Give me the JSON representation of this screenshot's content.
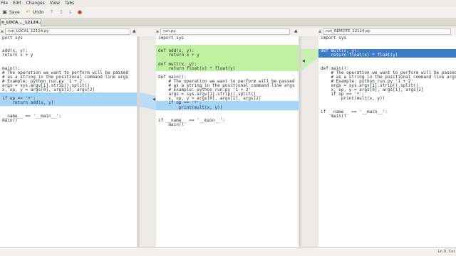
{
  "menu": [
    "File",
    "Edit",
    "Changes",
    "View",
    "Tabs"
  ],
  "toolbar": {
    "save": "Save",
    "undo": "Undo"
  },
  "tab": {
    "label": "n_LOCA..._12124.py"
  },
  "panes": {
    "left": {
      "file": "run_LOCAL_12124.py"
    },
    "middle": {
      "file": "run.py"
    },
    "right": {
      "file": "run_REMOTE_12124.py"
    }
  },
  "code": {
    "left": [
      {
        "t": "port sys",
        "c": ""
      },
      {
        "t": "",
        "c": ""
      },
      {
        "t": "",
        "c": ""
      },
      {
        "t": "add(x, y):",
        "c": ""
      },
      {
        "t": "return x + y",
        "c": ""
      },
      {
        "t": "",
        "c": ""
      },
      {
        "t": "",
        "c": ""
      },
      {
        "t": "main():",
        "c": ""
      },
      {
        "t": "# The operation we want to perform will be passed",
        "c": ""
      },
      {
        "t": "# as a string in the positional command line args",
        "c": ""
      },
      {
        "t": "# Example: python run.py '1 + 2'",
        "c": ""
      },
      {
        "t": "args = sys.argv[1].strip().split()",
        "c": ""
      },
      {
        "t": "x, op, y = args[0], args[1], args[2]",
        "c": ""
      },
      {
        "t": "",
        "c": "chg-b"
      },
      {
        "t": "if op == '+':",
        "c": "chg-b"
      },
      {
        "t": "    return add(x, y)",
        "c": "chg-b"
      },
      {
        "t": "",
        "c": ""
      },
      {
        "t": "",
        "c": ""
      },
      {
        "t": "__name__ == '__main__':",
        "c": ""
      },
      {
        "t": "main()",
        "c": ""
      }
    ],
    "middle": [
      {
        "t": "import sys",
        "c": ""
      },
      {
        "t": "",
        "c": ""
      },
      {
        "t": "",
        "c": "chg"
      },
      {
        "t": "def add(x, y):",
        "c": "chg"
      },
      {
        "t": "    return x + y",
        "c": "chg"
      },
      {
        "t": "",
        "c": "chg"
      },
      {
        "t": "def mult(x, y):",
        "c": "chg"
      },
      {
        "t": "    return float(x) * float(y)",
        "c": "chg"
      },
      {
        "t": "",
        "c": ""
      },
      {
        "t": "def main():",
        "c": ""
      },
      {
        "t": "    # The operation we want to perform will be passed",
        "c": ""
      },
      {
        "t": "    # as a string in the positional command line args",
        "c": ""
      },
      {
        "t": "    # Example: python run.py '1 + 2'",
        "c": ""
      },
      {
        "t": "    args = sys.argv[1].strip().split()",
        "c": ""
      },
      {
        "t": "    x, op, y = args[0], args[1], args[2]",
        "c": ""
      },
      {
        "t": "    if op == '*':",
        "c": "chg-b"
      },
      {
        "t": "        print(mult(x, y))",
        "c": "chg-b"
      },
      {
        "t": "",
        "c": ""
      },
      {
        "t": "",
        "c": ""
      },
      {
        "t": "if __name__ == '__main__':",
        "c": ""
      },
      {
        "t": "    main()",
        "c": ""
      }
    ],
    "right": [
      {
        "t": "import sys",
        "c": ""
      },
      {
        "t": "",
        "c": ""
      },
      {
        "t": "",
        "c": ""
      },
      {
        "t": "def mult(x, y):",
        "c": "sel"
      },
      {
        "t": "    return float(x) * float(y)",
        "c": "sel"
      },
      {
        "t": "",
        "c": ""
      },
      {
        "t": "",
        "c": ""
      },
      {
        "t": "def main():",
        "c": ""
      },
      {
        "t": "    # The operation we want to perform will be passed",
        "c": ""
      },
      {
        "t": "    # as a string in the positional command line args",
        "c": ""
      },
      {
        "t": "    # Example: python run.py '1 + 2'",
        "c": ""
      },
      {
        "t": "    args = sys.argv[1].strip().split()",
        "c": ""
      },
      {
        "t": "    x, op, y = args[0], args[1], args[2]",
        "c": ""
      },
      {
        "t": "    if op == '*':",
        "c": ""
      },
      {
        "t": "        print(mult(x, y))",
        "c": ""
      },
      {
        "t": "",
        "c": ""
      },
      {
        "t": "",
        "c": ""
      },
      {
        "t": "if __name__ == '__main__':",
        "c": ""
      },
      {
        "t": "    main()",
        "c": ""
      }
    ]
  },
  "status": "Ln 9, Col"
}
